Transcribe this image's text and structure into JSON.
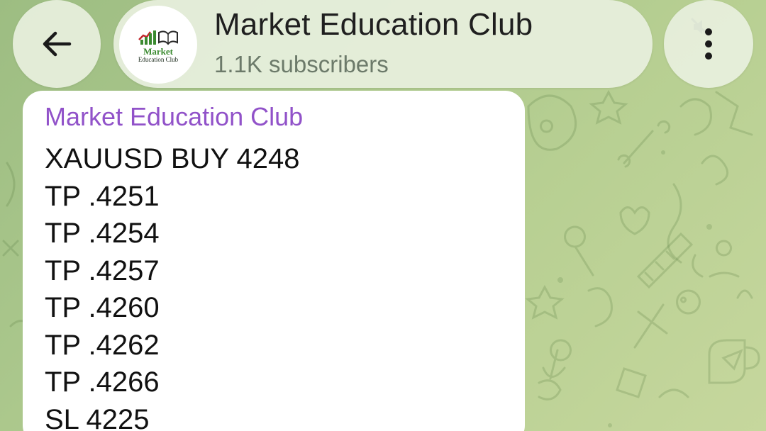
{
  "header": {
    "channel_title": "Market Education Club",
    "subscribers": "1.1K subscribers",
    "muted": true,
    "avatar": {
      "line1": "Market",
      "line2": "Education Club"
    }
  },
  "message": {
    "sender": "Market Education Club",
    "lines": [
      "XAUUSD BUY 4248",
      "TP .4251",
      "TP .4254",
      "TP .4257",
      "TP .4260",
      "TP .4262",
      "TP .4266",
      "SL 4225"
    ]
  },
  "colors": {
    "sender_name": "#9152c9",
    "wallpaper": "#a9c68b",
    "header_surface": "#e8f0de"
  }
}
